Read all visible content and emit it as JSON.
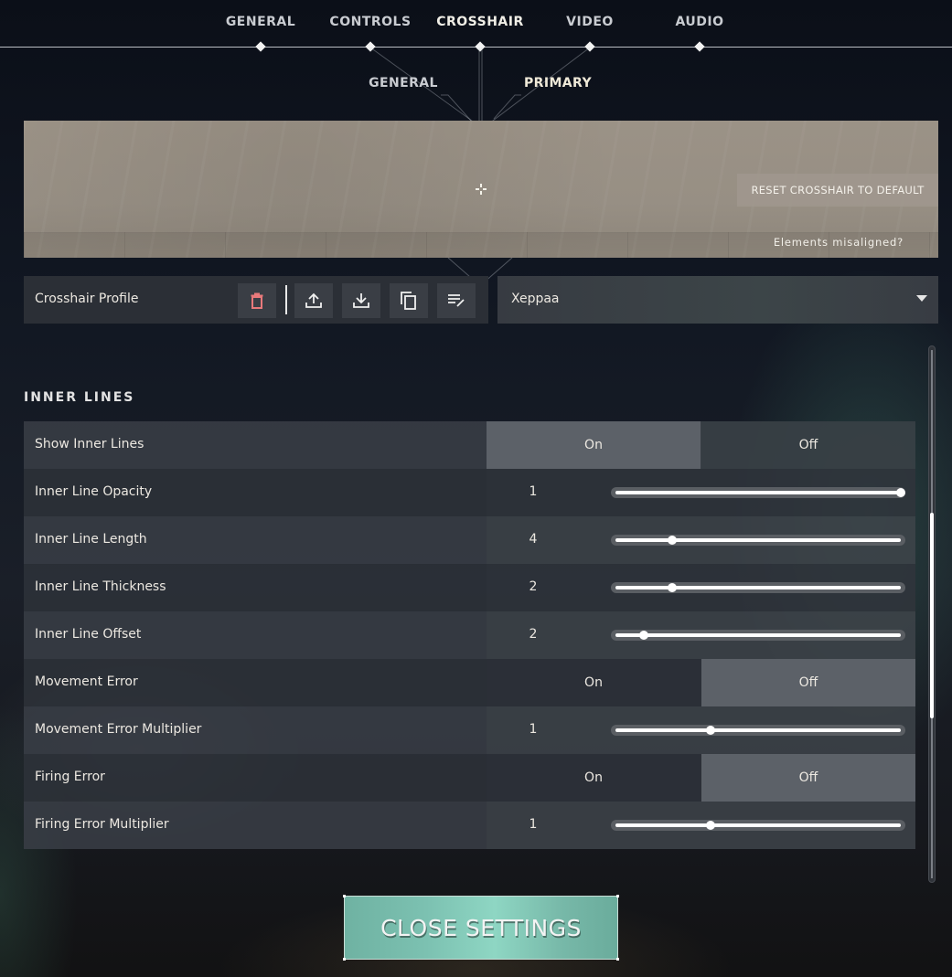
{
  "top_nav": {
    "tabs": [
      {
        "label": "GENERAL",
        "active": false
      },
      {
        "label": "CONTROLS",
        "active": false
      },
      {
        "label": "CROSSHAIR",
        "active": true
      },
      {
        "label": "VIDEO",
        "active": false
      },
      {
        "label": "AUDIO",
        "active": false
      }
    ]
  },
  "sub_nav": {
    "tabs": [
      {
        "label": "GENERAL",
        "active": false
      },
      {
        "label": "PRIMARY",
        "active": true
      }
    ]
  },
  "preview": {
    "reset_label": "RESET CROSSHAIR TO DEFAULT",
    "misaligned_label": "Elements misaligned?"
  },
  "profile": {
    "label": "Crosshair Profile",
    "selected": "Xeppaa",
    "actions": [
      "delete-icon",
      "upload-icon",
      "download-icon",
      "copy-icon",
      "rename-icon"
    ],
    "delete_color": "#e8797b"
  },
  "section": {
    "title": "INNER LINES",
    "rows": [
      {
        "label": "Show Inner Lines",
        "type": "toggle",
        "on_label": "On",
        "off_label": "Off",
        "value": "On"
      },
      {
        "label": "Inner Line Opacity",
        "type": "slider",
        "value": "1",
        "fraction": 1.0
      },
      {
        "label": "Inner Line Length",
        "type": "slider",
        "value": "4",
        "fraction": 0.2
      },
      {
        "label": "Inner Line Thickness",
        "type": "slider",
        "value": "2",
        "fraction": 0.2
      },
      {
        "label": "Inner Line Offset",
        "type": "slider",
        "value": "2",
        "fraction": 0.1
      },
      {
        "label": "Movement Error",
        "type": "toggle",
        "on_label": "On",
        "off_label": "Off",
        "value": "Off"
      },
      {
        "label": "Movement Error Multiplier",
        "type": "slider",
        "value": "1",
        "fraction": 0.333
      },
      {
        "label": "Firing Error",
        "type": "toggle",
        "on_label": "On",
        "off_label": "Off",
        "value": "Off"
      },
      {
        "label": "Firing Error Multiplier",
        "type": "slider",
        "value": "1",
        "fraction": 0.333
      }
    ]
  },
  "scroll": {
    "thumb_start": 0.31,
    "thumb_end": 0.695
  },
  "footer": {
    "close_label": "CLOSE SETTINGS",
    "accent": "#7cc1b1"
  }
}
